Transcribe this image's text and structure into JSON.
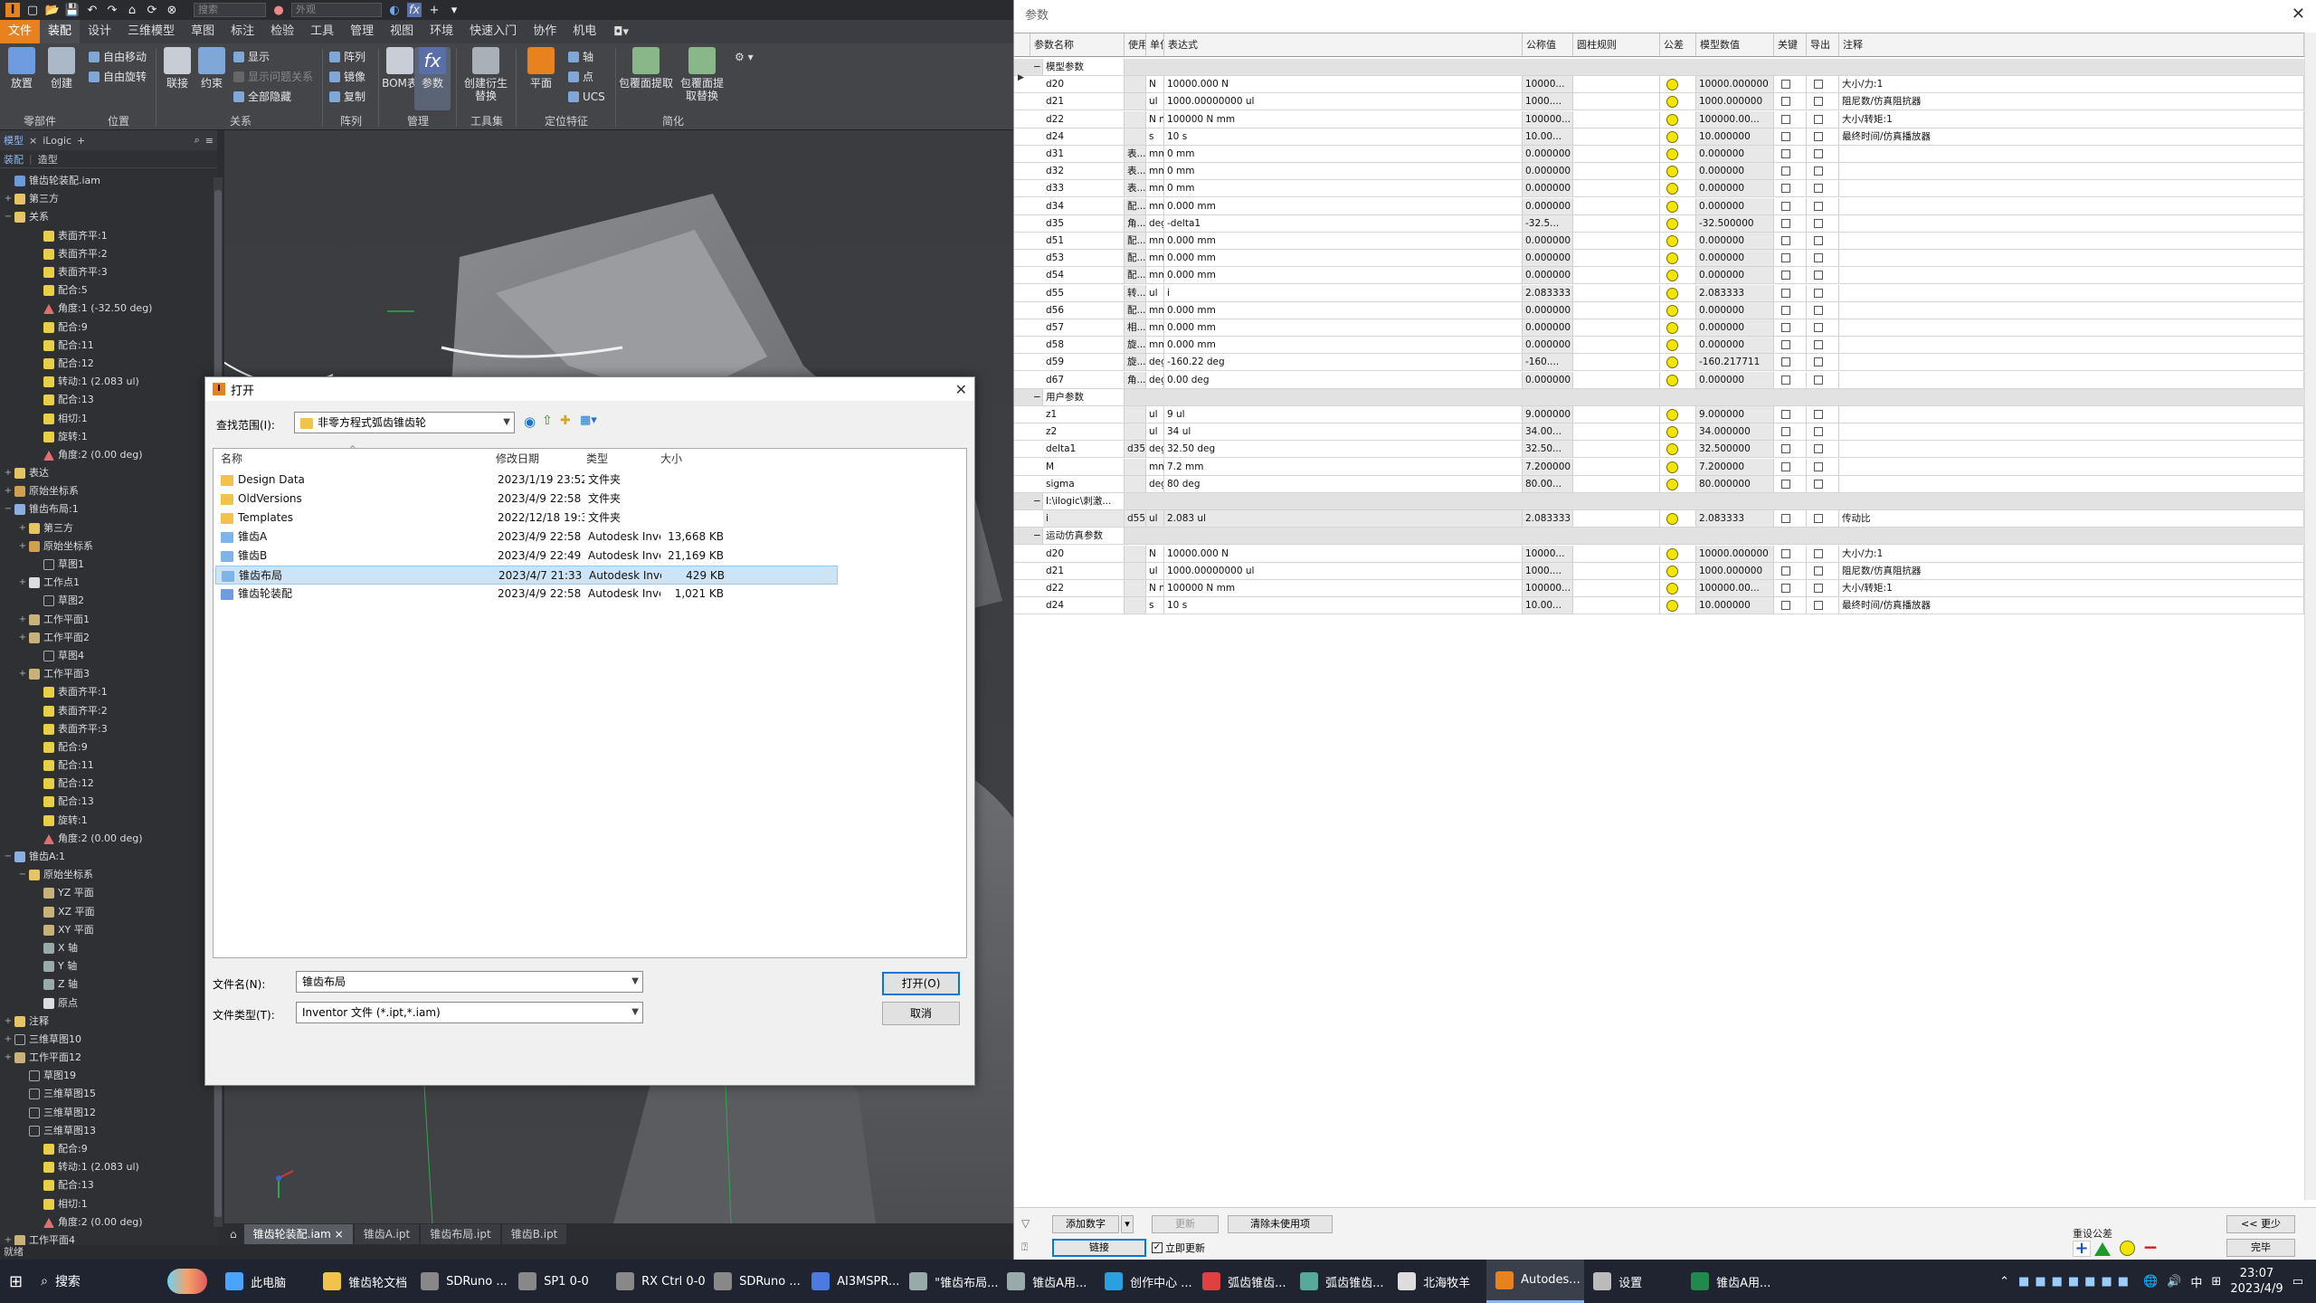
{
  "inventor": {
    "search_placeholder": "搜索",
    "appearance": "外观",
    "menus": [
      "文件",
      "装配",
      "设计",
      "三维模型",
      "草图",
      "标注",
      "检验",
      "工具",
      "管理",
      "视图",
      "环境",
      "快速入门",
      "协作",
      "机电"
    ],
    "ribbon": {
      "big_buttons": [
        "放置",
        "创建",
        "联接",
        "约束",
        "BOM表",
        "参数",
        "创建衍生替换",
        "平面",
        "包覆面提取",
        "包覆面提取替换"
      ],
      "small_buttons": [
        {
          "label": "自由移动",
          "disabled": false
        },
        {
          "label": "自由旋转",
          "disabled": false
        },
        {
          "label": "显示",
          "disabled": false
        },
        {
          "label": "显示问题关系",
          "disabled": true
        },
        {
          "label": "全部隐藏",
          "disabled": false
        },
        {
          "label": "阵列",
          "disabled": false
        },
        {
          "label": "镜像",
          "disabled": false
        },
        {
          "label": "复制",
          "disabled": false
        },
        {
          "label": "轴",
          "disabled": false
        },
        {
          "label": "点",
          "disabled": false
        },
        {
          "label": "UCS",
          "disabled": false
        }
      ],
      "groups": [
        "零部件",
        "位置",
        "关系",
        "阵列",
        "管理",
        "工具集",
        "定位特征",
        "简化"
      ]
    },
    "browser": {
      "tabs": [
        "模型",
        "iLogic",
        "+"
      ],
      "head": [
        "装配",
        "造型"
      ],
      "rows": [
        {
          "indent": 0,
          "exp": "",
          "icon": "asm",
          "label": "锥齿轮装配.iam"
        },
        {
          "indent": 0,
          "exp": "+",
          "icon": "folder",
          "label": "第三方"
        },
        {
          "indent": 0,
          "exp": "−",
          "icon": "folder",
          "label": "关系"
        },
        {
          "indent": 2,
          "exp": "",
          "icon": "cons",
          "label": "表面齐平:1"
        },
        {
          "indent": 2,
          "exp": "",
          "icon": "cons",
          "label": "表面齐平:2"
        },
        {
          "indent": 2,
          "exp": "",
          "icon": "cons",
          "label": "表面齐平:3"
        },
        {
          "indent": 2,
          "exp": "",
          "icon": "cons",
          "label": "配合:5"
        },
        {
          "indent": 2,
          "exp": "",
          "icon": "angle",
          "label": "角度:1 (-32.50 deg)"
        },
        {
          "indent": 2,
          "exp": "",
          "icon": "cons",
          "label": "配合:9"
        },
        {
          "indent": 2,
          "exp": "",
          "icon": "cons",
          "label": "配合:11"
        },
        {
          "indent": 2,
          "exp": "",
          "icon": "cons",
          "label": "配合:12"
        },
        {
          "indent": 2,
          "exp": "",
          "icon": "cons",
          "label": "转动:1 (2.083 ul)"
        },
        {
          "indent": 2,
          "exp": "",
          "icon": "cons",
          "label": "配合:13"
        },
        {
          "indent": 2,
          "exp": "",
          "icon": "cons",
          "label": "相切:1"
        },
        {
          "indent": 2,
          "exp": "",
          "icon": "cons",
          "label": "旋转:1"
        },
        {
          "indent": 2,
          "exp": "",
          "icon": "angle",
          "label": "角度:2 (0.00 deg)"
        },
        {
          "indent": 0,
          "exp": "+",
          "icon": "folder",
          "label": "表达"
        },
        {
          "indent": 0,
          "exp": "+",
          "icon": "origin",
          "label": "原始坐标系"
        },
        {
          "indent": 0,
          "exp": "−",
          "icon": "part",
          "label": "锥齿布局:1"
        },
        {
          "indent": 1,
          "exp": "+",
          "icon": "folder",
          "label": "第三方"
        },
        {
          "indent": 1,
          "exp": "+",
          "icon": "origin",
          "label": "原始坐标系"
        },
        {
          "indent": 2,
          "exp": "",
          "icon": "sketch",
          "label": "草图1"
        },
        {
          "indent": 1,
          "exp": "+",
          "icon": "point",
          "label": "工作点1"
        },
        {
          "indent": 2,
          "exp": "",
          "icon": "sketch",
          "label": "草图2"
        },
        {
          "indent": 1,
          "exp": "+",
          "icon": "plane",
          "label": "工作平面1"
        },
        {
          "indent": 1,
          "exp": "+",
          "icon": "plane",
          "label": "工作平面2"
        },
        {
          "indent": 2,
          "exp": "",
          "icon": "sketch",
          "label": "草图4"
        },
        {
          "indent": 1,
          "exp": "+",
          "icon": "plane",
          "label": "工作平面3"
        },
        {
          "indent": 2,
          "exp": "",
          "icon": "cons",
          "label": "表面齐平:1"
        },
        {
          "indent": 2,
          "exp": "",
          "icon": "cons",
          "label": "表面齐平:2"
        },
        {
          "indent": 2,
          "exp": "",
          "icon": "cons",
          "label": "表面齐平:3"
        },
        {
          "indent": 2,
          "exp": "",
          "icon": "cons",
          "label": "配合:9"
        },
        {
          "indent": 2,
          "exp": "",
          "icon": "cons",
          "label": "配合:11"
        },
        {
          "indent": 2,
          "exp": "",
          "icon": "cons",
          "label": "配合:12"
        },
        {
          "indent": 2,
          "exp": "",
          "icon": "cons",
          "label": "配合:13"
        },
        {
          "indent": 2,
          "exp": "",
          "icon": "cons",
          "label": "旋转:1"
        },
        {
          "indent": 2,
          "exp": "",
          "icon": "angle",
          "label": "角度:2 (0.00 deg)"
        },
        {
          "indent": 0,
          "exp": "−",
          "icon": "part",
          "label": "锥齿A:1"
        },
        {
          "indent": 1,
          "exp": "−",
          "icon": "folder",
          "label": "原始坐标系"
        },
        {
          "indent": 2,
          "exp": "",
          "icon": "plane",
          "label": "YZ 平面"
        },
        {
          "indent": 2,
          "exp": "",
          "icon": "plane",
          "label": "XZ 平面"
        },
        {
          "indent": 2,
          "exp": "",
          "icon": "plane",
          "label": "XY 平面"
        },
        {
          "indent": 2,
          "exp": "",
          "icon": "axis",
          "label": "X 轴"
        },
        {
          "indent": 2,
          "exp": "",
          "icon": "axis",
          "label": "Y 轴"
        },
        {
          "indent": 2,
          "exp": "",
          "icon": "axis",
          "label": "Z 轴"
        },
        {
          "indent": 2,
          "exp": "",
          "icon": "point",
          "label": "原点"
        },
        {
          "indent": 0,
          "exp": "+",
          "icon": "folder",
          "label": "注释"
        },
        {
          "indent": 0,
          "exp": "+",
          "icon": "sketch",
          "label": "三维草图10"
        },
        {
          "indent": 0,
          "exp": "+",
          "icon": "plane",
          "label": "工作平面12"
        },
        {
          "indent": 1,
          "exp": "",
          "icon": "sketch",
          "label": "草图19"
        },
        {
          "indent": 1,
          "exp": "",
          "icon": "sketch",
          "label": "三维草图15"
        },
        {
          "indent": 1,
          "exp": "",
          "icon": "sketch",
          "label": "三维草图12"
        },
        {
          "indent": 1,
          "exp": "",
          "icon": "sketch",
          "label": "三维草图13"
        },
        {
          "indent": 2,
          "exp": "",
          "icon": "cons",
          "label": "配合:9"
        },
        {
          "indent": 2,
          "exp": "",
          "icon": "cons",
          "label": "转动:1 (2.083 ul)"
        },
        {
          "indent": 2,
          "exp": "",
          "icon": "cons",
          "label": "配合:13"
        },
        {
          "indent": 2,
          "exp": "",
          "icon": "cons",
          "label": "相切:1"
        },
        {
          "indent": 2,
          "exp": "",
          "icon": "angle",
          "label": "角度:2 (0.00 deg)"
        },
        {
          "indent": 0,
          "exp": "+",
          "icon": "plane",
          "label": "工作平面4"
        }
      ]
    },
    "doc_tabs": [
      "锥齿轮装配.iam",
      "锥齿A.ipt",
      "锥齿布局.ipt",
      "锥齿B.ipt"
    ],
    "status": "就绪"
  },
  "open_dialog": {
    "title": "打开",
    "look_in_label": "查找范围(I):",
    "look_in_value": "非零方程式弧齿锥齿轮",
    "columns": [
      "名称",
      "修改日期",
      "类型",
      "大小"
    ],
    "files": [
      {
        "name": "Design Data",
        "date": "2023/1/19 23:52",
        "type": "文件夹",
        "size": "",
        "icon": "folder"
      },
      {
        "name": "OldVersions",
        "date": "2023/4/9 22:58",
        "type": "文件夹",
        "size": "",
        "icon": "folder"
      },
      {
        "name": "Templates",
        "date": "2022/12/18 19:33",
        "type": "文件夹",
        "size": "",
        "icon": "folder"
      },
      {
        "name": "锥齿A",
        "date": "2023/4/9 22:58",
        "type": "Autodesk Inventor ...",
        "size": "13,668 KB",
        "icon": "ipt"
      },
      {
        "name": "锥齿B",
        "date": "2023/4/9 22:49",
        "type": "Autodesk Inventor ...",
        "size": "21,169 KB",
        "icon": "ipt"
      },
      {
        "name": "锥齿布局",
        "date": "2023/4/7 21:33",
        "type": "Autodesk Inventor ...",
        "size": "429 KB",
        "icon": "ipt",
        "selected": true
      },
      {
        "name": "锥齿轮装配",
        "date": "2023/4/9 22:58",
        "type": "Autodesk Inventor ...",
        "size": "1,021 KB",
        "icon": "iam"
      }
    ],
    "filename_label": "文件名(N):",
    "filename_value": "锥齿布局",
    "filetype_label": "文件类型(T):",
    "filetype_value": "Inventor 文件 (*.ipt,*.iam)",
    "open_button": "打开(O)",
    "cancel_button": "取消"
  },
  "params": {
    "title": "参数",
    "columns": [
      "参数名称",
      "使用",
      "单位",
      "表达式",
      "公称值",
      "圆柱规则",
      "公差",
      "模型数值",
      "关键",
      "导出",
      "注释"
    ],
    "rows": [
      {
        "kind": "group",
        "name": "模型参数"
      },
      {
        "name": "d20",
        "used": "",
        "unit": "N",
        "expr": "10000.000 N",
        "nominal": "10000...",
        "model": "10000.000000",
        "comment": "大小/力:1"
      },
      {
        "name": "d21",
        "used": "",
        "unit": "ul",
        "expr": "1000.00000000 ul",
        "nominal": "1000....",
        "model": "1000.000000",
        "comment": "阻尼数/仿真阻抗器"
      },
      {
        "name": "d22",
        "used": "",
        "unit": "N mm",
        "expr": "100000 N mm",
        "nominal": "100000...",
        "model": "100000.00...",
        "comment": "大小/转矩:1"
      },
      {
        "name": "d24",
        "used": "",
        "unit": "s",
        "expr": "10 s",
        "nominal": "10.00...",
        "model": "10.000000",
        "comment": "最终时间/仿真播放器"
      },
      {
        "name": "d31",
        "used": "表...",
        "unit": "mm",
        "expr": "0 mm",
        "nominal": "0.000000",
        "model": "0.000000",
        "comment": ""
      },
      {
        "name": "d32",
        "used": "表...",
        "unit": "mm",
        "expr": "0 mm",
        "nominal": "0.000000",
        "model": "0.000000",
        "comment": ""
      },
      {
        "name": "d33",
        "used": "表...",
        "unit": "mm",
        "expr": "0 mm",
        "nominal": "0.000000",
        "model": "0.000000",
        "comment": ""
      },
      {
        "name": "d34",
        "used": "配...",
        "unit": "mm",
        "expr": "0.000 mm",
        "nominal": "0.000000",
        "model": "0.000000",
        "comment": ""
      },
      {
        "name": "d35",
        "used": "角...",
        "unit": "deg",
        "expr": "-delta1",
        "nominal": "-32.5...",
        "model": "-32.500000",
        "comment": ""
      },
      {
        "name": "d51",
        "used": "配...",
        "unit": "mm",
        "expr": "0.000 mm",
        "nominal": "0.000000",
        "model": "0.000000",
        "comment": ""
      },
      {
        "name": "d53",
        "used": "配...",
        "unit": "mm",
        "expr": "0.000 mm",
        "nominal": "0.000000",
        "model": "0.000000",
        "comment": ""
      },
      {
        "name": "d54",
        "used": "配...",
        "unit": "mm",
        "expr": "0.000 mm",
        "nominal": "0.000000",
        "model": "0.000000",
        "comment": ""
      },
      {
        "name": "d55",
        "used": "转...",
        "unit": "ul",
        "expr": "i",
        "nominal": "2.083333",
        "model": "2.083333",
        "comment": ""
      },
      {
        "name": "d56",
        "used": "配...",
        "unit": "mm",
        "expr": "0.000 mm",
        "nominal": "0.000000",
        "model": "0.000000",
        "comment": ""
      },
      {
        "name": "d57",
        "used": "相...",
        "unit": "mm",
        "expr": "0.000 mm",
        "nominal": "0.000000",
        "model": "0.000000",
        "comment": ""
      },
      {
        "name": "d58",
        "used": "旋...",
        "unit": "mm",
        "expr": "0.000 mm",
        "nominal": "0.000000",
        "model": "0.000000",
        "comment": ""
      },
      {
        "name": "d59",
        "used": "旋...",
        "unit": "deg",
        "expr": "-160.22 deg",
        "nominal": "-160....",
        "model": "-160.217711",
        "comment": ""
      },
      {
        "name": "d67",
        "used": "角...",
        "unit": "deg",
        "expr": "0.00 deg",
        "nominal": "0.000000",
        "model": "0.000000",
        "comment": ""
      },
      {
        "kind": "group",
        "name": "用户参数"
      },
      {
        "name": "z1",
        "used": "",
        "unit": "ul",
        "expr": "9 ul",
        "nominal": "9.000000",
        "model": "9.000000",
        "comment": ""
      },
      {
        "name": "z2",
        "used": "",
        "unit": "ul",
        "expr": "34 ul",
        "nominal": "34.00...",
        "model": "34.000000",
        "comment": ""
      },
      {
        "name": "delta1",
        "used": "d35",
        "unit": "deg",
        "expr": "32.50 deg",
        "nominal": "32.50...",
        "model": "32.500000",
        "comment": ""
      },
      {
        "name": "M",
        "used": "",
        "unit": "mm",
        "expr": "7.2 mm",
        "nominal": "7.200000",
        "model": "7.200000",
        "comment": ""
      },
      {
        "name": "sigma",
        "used": "",
        "unit": "deg",
        "expr": "80 deg",
        "nominal": "80.00...",
        "model": "80.000000",
        "comment": ""
      },
      {
        "kind": "group",
        "name": "I:\\ilogic\\刺激..."
      },
      {
        "name": "i",
        "used": "d55",
        "unit": "ul",
        "expr": "2.083 ul",
        "nominal": "2.083333",
        "model": "2.083333",
        "comment": "传动比",
        "grey": true
      },
      {
        "kind": "group",
        "name": "运动仿真参数"
      },
      {
        "name": "d20",
        "used": "",
        "unit": "N",
        "expr": "10000.000 N",
        "nominal": "10000...",
        "model": "10000.000000",
        "comment": "大小/力:1"
      },
      {
        "name": "d21",
        "used": "",
        "unit": "ul",
        "expr": "1000.00000000 ul",
        "nominal": "1000....",
        "model": "1000.000000",
        "comment": "阻尼数/仿真阻抗器"
      },
      {
        "name": "d22",
        "used": "",
        "unit": "N mm",
        "expr": "100000 N mm",
        "nominal": "100000...",
        "model": "100000.00...",
        "comment": "大小/转矩:1"
      },
      {
        "name": "d24",
        "used": "",
        "unit": "s",
        "expr": "10 s",
        "nominal": "10.00...",
        "model": "10.000000",
        "comment": "最终时间/仿真播放器"
      }
    ],
    "bottom": {
      "add_number": "添加数字",
      "update": "更新",
      "purge": "清除未使用项",
      "link": "链接",
      "immediate_update": "立即更新",
      "reset_tolerance": "重设公差",
      "less": "<< 更少",
      "done": "完毕"
    }
  },
  "taskbar": {
    "search": "搜索",
    "items": [
      {
        "label": "此电脑",
        "color": "#4aa3ff"
      },
      {
        "label": "锥齿轮文档",
        "color": "#f1c34a"
      },
      {
        "label": "SDRuno ...",
        "color": "#888"
      },
      {
        "label": "SP1 0-0",
        "color": "#888"
      },
      {
        "label": "RX Ctrl 0-0",
        "color": "#888"
      },
      {
        "label": "SDRuno ...",
        "color": "#888"
      },
      {
        "label": "AI3MSPR...",
        "color": "#4a7be0"
      },
      {
        "label": "\"锥齿布局...",
        "color": "#9aa"
      },
      {
        "label": "锥齿A用...",
        "color": "#9aa"
      },
      {
        "label": "创作中心 ...",
        "color": "#2aa0e0"
      },
      {
        "label": "弧齿锥齿...",
        "color": "#e04040"
      },
      {
        "label": "弧齿锥齿...",
        "color": "#5a9"
      },
      {
        "label": "北海牧羊",
        "color": "#ddd"
      },
      {
        "label": "Autodes...",
        "color": "#e8821e",
        "active": true
      },
      {
        "label": "设置",
        "color": "#bbb"
      },
      {
        "label": "锥齿A用...",
        "color": "#1f8a4c"
      }
    ],
    "ime": "中",
    "time": "23:07",
    "date": "2023/4/9"
  }
}
